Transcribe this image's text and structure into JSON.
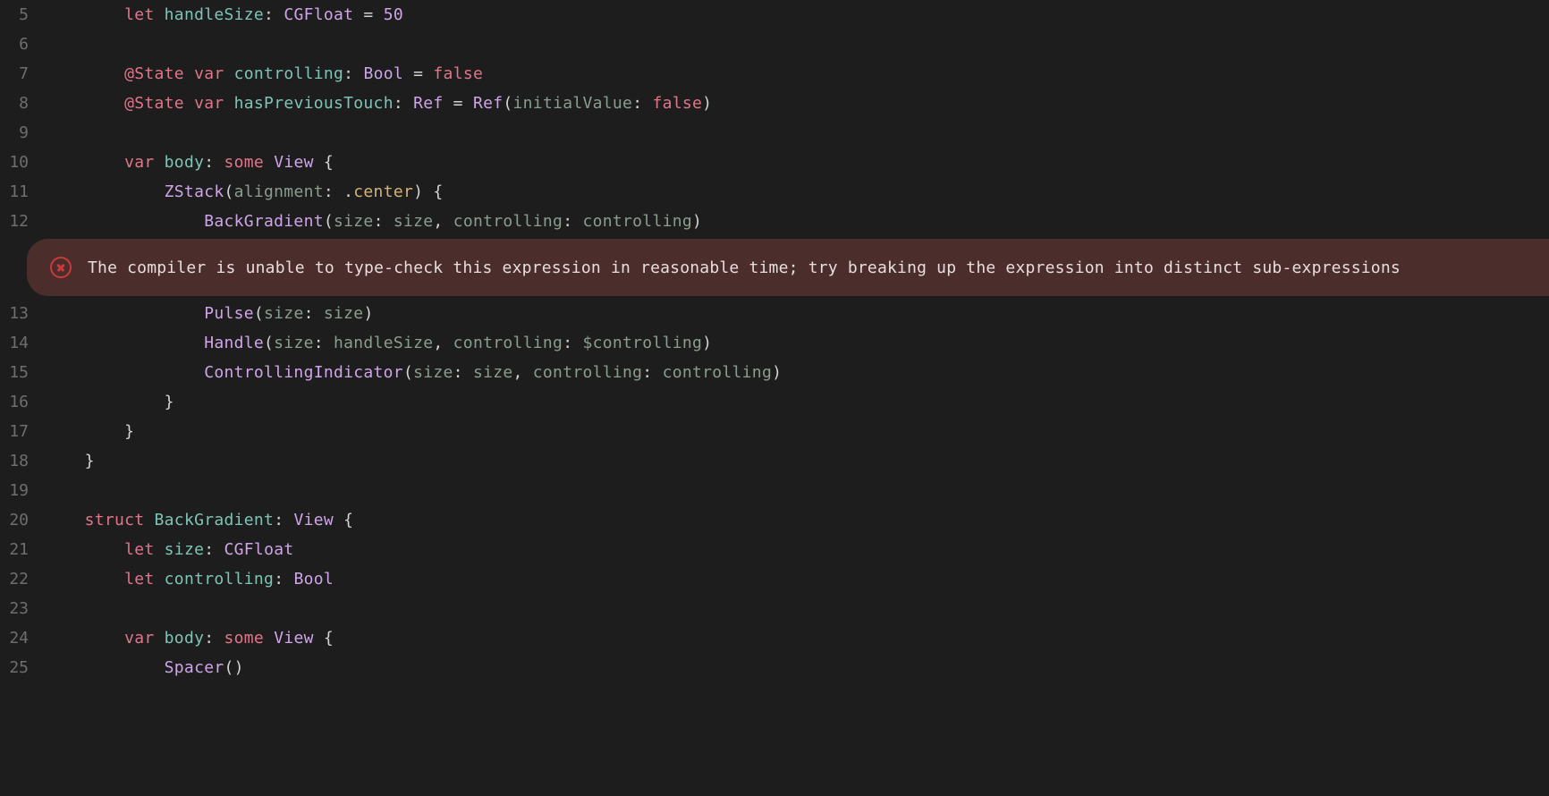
{
  "error": {
    "message": "The compiler is unable to type-check this expression in reasonable time; try breaking up the expression into distinct sub-expressions"
  },
  "lines": [
    {
      "num": "5",
      "tokens": [
        [
          "        ",
          ""
        ],
        [
          "let",
          "keyword"
        ],
        [
          " ",
          ""
        ],
        [
          "handleSize",
          "ident"
        ],
        [
          ": ",
          "punct"
        ],
        [
          "CGFloat",
          "type"
        ],
        [
          " = ",
          "punct"
        ],
        [
          "50",
          "num"
        ]
      ]
    },
    {
      "num": "6",
      "tokens": []
    },
    {
      "num": "7",
      "tokens": [
        [
          "        ",
          ""
        ],
        [
          "@State",
          "attr"
        ],
        [
          " ",
          ""
        ],
        [
          "var",
          "keyword"
        ],
        [
          " ",
          ""
        ],
        [
          "controlling",
          "ident"
        ],
        [
          ": ",
          "punct"
        ],
        [
          "Bool",
          "type"
        ],
        [
          " = ",
          "punct"
        ],
        [
          "false",
          "value"
        ]
      ]
    },
    {
      "num": "8",
      "tokens": [
        [
          "        ",
          ""
        ],
        [
          "@State",
          "attr"
        ],
        [
          " ",
          ""
        ],
        [
          "var",
          "keyword"
        ],
        [
          " ",
          ""
        ],
        [
          "hasPreviousTouch",
          "ident"
        ],
        [
          ": ",
          "punct"
        ],
        [
          "Ref",
          "type"
        ],
        [
          " = ",
          "punct"
        ],
        [
          "Ref",
          "type"
        ],
        [
          "(",
          "punct"
        ],
        [
          "initialValue",
          "muted"
        ],
        [
          ": ",
          "punct"
        ],
        [
          "false",
          "value"
        ],
        [
          ")",
          "punct"
        ]
      ]
    },
    {
      "num": "9",
      "tokens": []
    },
    {
      "num": "10",
      "tokens": [
        [
          "        ",
          ""
        ],
        [
          "var",
          "keyword"
        ],
        [
          " ",
          ""
        ],
        [
          "body",
          "ident"
        ],
        [
          ": ",
          "punct"
        ],
        [
          "some",
          "keyword"
        ],
        [
          " ",
          ""
        ],
        [
          "View",
          "type"
        ],
        [
          " {",
          "punct"
        ]
      ]
    },
    {
      "num": "11",
      "tokens": [
        [
          "            ",
          ""
        ],
        [
          "ZStack",
          "type"
        ],
        [
          "(",
          "punct"
        ],
        [
          "alignment",
          "muted"
        ],
        [
          ": .",
          "punct"
        ],
        [
          "center",
          "member"
        ],
        [
          ") {",
          "punct"
        ]
      ]
    },
    {
      "num": "12",
      "tokens": [
        [
          "                ",
          ""
        ],
        [
          "BackGradient",
          "type"
        ],
        [
          "(",
          "punct"
        ],
        [
          "size",
          "muted"
        ],
        [
          ": ",
          "punct"
        ],
        [
          "size",
          "muted"
        ],
        [
          ", ",
          "punct"
        ],
        [
          "controlling",
          "muted"
        ],
        [
          ": ",
          "punct"
        ],
        [
          "controlling",
          "muted"
        ],
        [
          ")",
          "punct"
        ]
      ]
    }
  ],
  "lines_after": [
    {
      "num": "13",
      "tokens": [
        [
          "                ",
          ""
        ],
        [
          "Pulse",
          "type"
        ],
        [
          "(",
          "punct"
        ],
        [
          "size",
          "muted"
        ],
        [
          ": ",
          "punct"
        ],
        [
          "size",
          "muted"
        ],
        [
          ")",
          "punct"
        ]
      ]
    },
    {
      "num": "14",
      "tokens": [
        [
          "                ",
          ""
        ],
        [
          "Handle",
          "type"
        ],
        [
          "(",
          "punct"
        ],
        [
          "size",
          "muted"
        ],
        [
          ": ",
          "punct"
        ],
        [
          "handleSize",
          "muted"
        ],
        [
          ", ",
          "punct"
        ],
        [
          "controlling",
          "muted"
        ],
        [
          ": ",
          "punct"
        ],
        [
          "$controlling",
          "muted"
        ],
        [
          ")",
          "punct"
        ]
      ]
    },
    {
      "num": "15",
      "tokens": [
        [
          "                ",
          ""
        ],
        [
          "ControllingIndicator",
          "type"
        ],
        [
          "(",
          "punct"
        ],
        [
          "size",
          "muted"
        ],
        [
          ": ",
          "punct"
        ],
        [
          "size",
          "muted"
        ],
        [
          ", ",
          "punct"
        ],
        [
          "controlling",
          "muted"
        ],
        [
          ": ",
          "punct"
        ],
        [
          "controlling",
          "muted"
        ],
        [
          ")",
          "punct"
        ]
      ]
    },
    {
      "num": "16",
      "tokens": [
        [
          "            ",
          ""
        ],
        [
          "}",
          "punct"
        ]
      ]
    },
    {
      "num": "17",
      "tokens": [
        [
          "        ",
          ""
        ],
        [
          "}",
          "punct"
        ]
      ]
    },
    {
      "num": "18",
      "tokens": [
        [
          "    ",
          ""
        ],
        [
          "}",
          "punct"
        ]
      ]
    },
    {
      "num": "19",
      "tokens": []
    },
    {
      "num": "20",
      "tokens": [
        [
          "    ",
          ""
        ],
        [
          "struct",
          "keyword"
        ],
        [
          " ",
          ""
        ],
        [
          "BackGradient",
          "ident"
        ],
        [
          ": ",
          "punct"
        ],
        [
          "View",
          "type"
        ],
        [
          " {",
          "punct"
        ]
      ]
    },
    {
      "num": "21",
      "tokens": [
        [
          "        ",
          ""
        ],
        [
          "let",
          "keyword"
        ],
        [
          " ",
          ""
        ],
        [
          "size",
          "ident"
        ],
        [
          ": ",
          "punct"
        ],
        [
          "CGFloat",
          "type"
        ]
      ]
    },
    {
      "num": "22",
      "tokens": [
        [
          "        ",
          ""
        ],
        [
          "let",
          "keyword"
        ],
        [
          " ",
          ""
        ],
        [
          "controlling",
          "ident"
        ],
        [
          ": ",
          "punct"
        ],
        [
          "Bool",
          "type"
        ]
      ]
    },
    {
      "num": "23",
      "tokens": []
    },
    {
      "num": "24",
      "tokens": [
        [
          "        ",
          ""
        ],
        [
          "var",
          "keyword"
        ],
        [
          " ",
          ""
        ],
        [
          "body",
          "ident"
        ],
        [
          ": ",
          "punct"
        ],
        [
          "some",
          "keyword"
        ],
        [
          " ",
          ""
        ],
        [
          "View",
          "type"
        ],
        [
          " {",
          "punct"
        ]
      ]
    },
    {
      "num": "25",
      "tokens": [
        [
          "            ",
          ""
        ],
        [
          "Spacer",
          "type"
        ],
        [
          "()",
          "punct"
        ]
      ]
    }
  ]
}
